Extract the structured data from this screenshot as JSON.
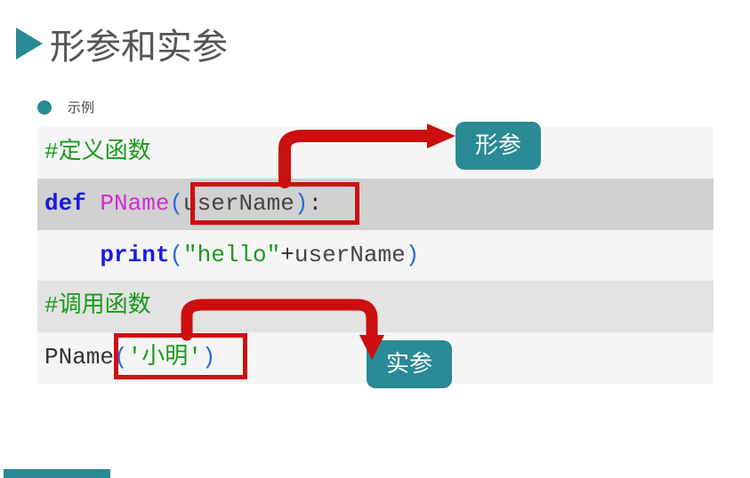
{
  "title": "形参和实参",
  "subtitle": "示例",
  "code": {
    "line1_comment": "#定义函数",
    "line2_def": "def ",
    "line2_fname": "PName",
    "line2_open": "(",
    "line2_param": "userName",
    "line2_close": ")",
    "line2_colon": ":",
    "line3_indent": "    ",
    "line3_print": "print",
    "line3_open": "(",
    "line3_str": "\"hello\"",
    "line3_plus": "+",
    "line3_arg": "userName",
    "line3_close": ")",
    "line4_comment": "#调用函数",
    "line5_call": "PName",
    "line5_open": "(",
    "line5_arg": "'小明'",
    "line5_close": ")"
  },
  "labels": {
    "formal": "形参",
    "actual": "实参"
  }
}
